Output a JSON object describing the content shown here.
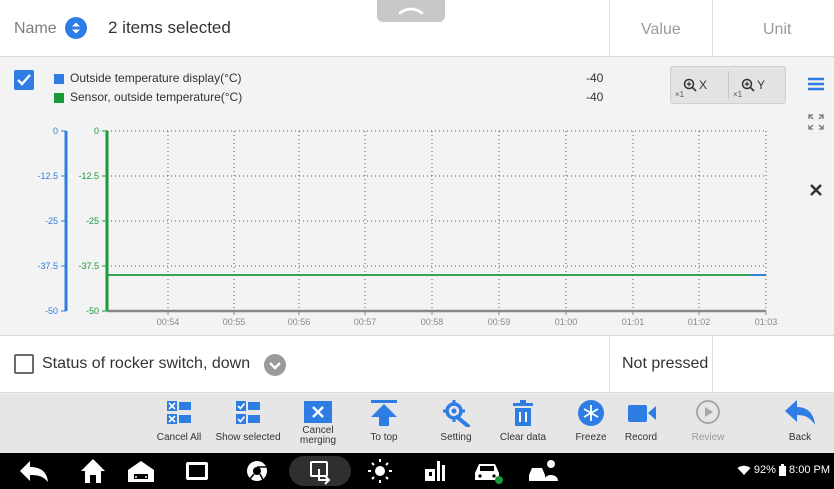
{
  "header": {
    "name_label": "Name",
    "selected_text": "2 items selected",
    "value_label": "Value",
    "unit_label": "Unit"
  },
  "graph": {
    "legend": [
      {
        "label": "Outside temperature display(°C)",
        "value": "-40",
        "color": "#2e7de4"
      },
      {
        "label": "Sensor, outside temperature(°C)",
        "value": "-40",
        "color": "#1a9a3a"
      }
    ],
    "zoom_x_label": "X",
    "zoom_x_scale": "×1",
    "zoom_y_label": "Y",
    "zoom_y_scale": "×1"
  },
  "chart_data": {
    "type": "line",
    "x": [
      "00:54",
      "00:55",
      "00:56",
      "00:57",
      "00:58",
      "00:59",
      "01:00",
      "01:01",
      "01:02",
      "01:03"
    ],
    "yticks": [
      "0",
      "-12.5",
      "-25",
      "-37.5",
      "-50"
    ],
    "ylim": [
      -50,
      0
    ],
    "series": [
      {
        "name": "Outside temperature display(°C)",
        "color": "#2e7de4",
        "values": [
          -40,
          -40,
          -40,
          -40,
          -40,
          -40,
          -40,
          -40,
          -40,
          -40
        ]
      },
      {
        "name": "Sensor, outside temperature(°C)",
        "color": "#1a9a3a",
        "values": [
          -40,
          -40,
          -40,
          -40,
          -40,
          -40,
          -40,
          -40,
          -40,
          -40
        ]
      }
    ],
    "grid": true
  },
  "row": {
    "name": "Status of rocker switch, down",
    "value": "Not pressed"
  },
  "toolbar": [
    {
      "label": "Cancel All",
      "icon": "cancel-all-icon"
    },
    {
      "label": "Show selected",
      "icon": "show-selected-icon"
    },
    {
      "label": "Cancel merging",
      "icon": "cancel-merging-icon"
    },
    {
      "label": "To top",
      "icon": "to-top-icon"
    },
    {
      "label": "Setting",
      "icon": "setting-icon"
    },
    {
      "label": "Clear data",
      "icon": "clear-data-icon"
    },
    {
      "label": "Freeze",
      "icon": "freeze-icon"
    },
    {
      "label": "Record",
      "icon": "record-icon"
    },
    {
      "label": "Review",
      "icon": "review-icon"
    },
    {
      "label": "Back",
      "icon": "back-icon"
    }
  ],
  "status": {
    "battery": "92%",
    "time": "8:00 PM"
  },
  "colors": {
    "accent": "#2e7de4",
    "series_green": "#1a9a3a"
  }
}
